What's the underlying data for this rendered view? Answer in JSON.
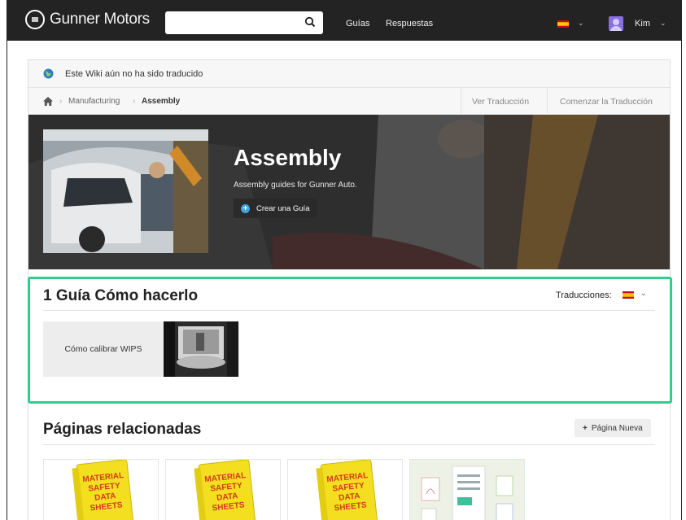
{
  "header": {
    "brand": "Gunner Motors",
    "search_placeholder": "",
    "nav": [
      "Guías",
      "Respuestas"
    ],
    "user_name": "Kim",
    "language_flag": "es"
  },
  "notice": {
    "text": "Este Wiki aún no ha sido traducido"
  },
  "breadcrumb": {
    "items": [
      "Manufacturing",
      "Assembly"
    ],
    "actions": [
      "Ver Traducción",
      "Comenzar la Traducción"
    ]
  },
  "hero": {
    "title": "Assembly",
    "subtitle": "Assembly guides for Gunner Auto.",
    "button_label": "Crear una Guía"
  },
  "guides": {
    "title": "1 Guía Cómo hacerlo",
    "translations_label": "Traducciones:",
    "items": [
      {
        "title": "Cómo calibrar WIPS"
      }
    ]
  },
  "related": {
    "title": "Páginas relacionadas",
    "new_page_label": "Página Nueva",
    "cards": [
      {
        "binder_text": [
          "MATERIAL",
          "SAFETY",
          "DATA",
          "SHEETS"
        ]
      },
      {
        "binder_text": [
          "MATERIAL",
          "SAFETY",
          "DATA",
          "SHEETS"
        ]
      },
      {
        "binder_text": [
          "MATERIAL",
          "SAFETY",
          "DATA",
          "SHEETS"
        ]
      },
      {
        "type": "documents-illustration"
      }
    ]
  },
  "colors": {
    "navbar": "#232323",
    "highlight": "#2ecf8c",
    "accent_blue": "#3ea7e0",
    "binder_yellow": "#f3df1f",
    "binder_red": "#d23a1a"
  }
}
